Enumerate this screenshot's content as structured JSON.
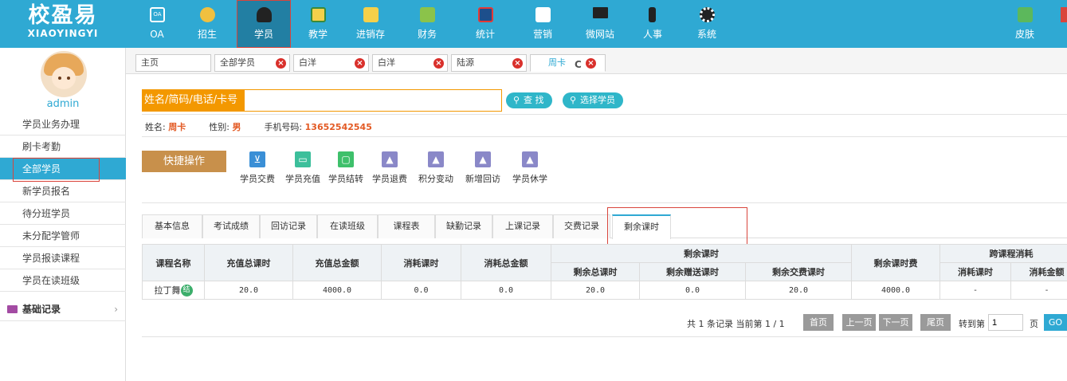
{
  "logo": {
    "cn": "校盈易",
    "en": "XIAOYINGYI"
  },
  "nav": [
    {
      "label": "OA",
      "icon": "oa-icon",
      "color": "#2fa9d3"
    },
    {
      "label": "招生",
      "icon": "recruit-icon",
      "color": "#f0c040"
    },
    {
      "label": "学员",
      "icon": "student-icon",
      "color": "#222222"
    },
    {
      "label": "教学",
      "icon": "teaching-icon",
      "color": "#f5d04a"
    },
    {
      "label": "进销存",
      "icon": "inventory-icon",
      "color": "#f5d04a"
    },
    {
      "label": "财务",
      "icon": "finance-icon",
      "color": "#8bc34a"
    },
    {
      "label": "统计",
      "icon": "statistics-icon",
      "color": "#e53935"
    },
    {
      "label": "营销",
      "icon": "marketing-icon",
      "color": "#ffffff"
    },
    {
      "label": "微网站",
      "icon": "website-icon",
      "color": "#222222"
    },
    {
      "label": "人事",
      "icon": "hr-icon",
      "color": "#222222"
    },
    {
      "label": "系统",
      "icon": "settings-icon",
      "color": "#222222"
    }
  ],
  "skin": {
    "label": "皮肤",
    "icon": "skin-icon"
  },
  "user": {
    "name": "admin"
  },
  "sidebar": {
    "items": [
      {
        "label": "学员业务办理"
      },
      {
        "label": "刷卡考勤"
      },
      {
        "label": "全部学员"
      },
      {
        "label": "新学员报名"
      },
      {
        "label": "待分班学员"
      },
      {
        "label": "未分配学管师"
      },
      {
        "label": "学员报读课程"
      },
      {
        "label": "学员在读班级"
      }
    ],
    "group": {
      "label": "基础记录",
      "chevron": "›"
    }
  },
  "page_tabs": [
    {
      "label": "主页"
    },
    {
      "label": "全部学员"
    },
    {
      "label": "白洋"
    },
    {
      "label": "白洋"
    },
    {
      "label": "陆源"
    },
    {
      "label": "周卡"
    }
  ],
  "search": {
    "placeholder": "姓名/简码/电话/卡号",
    "search_button": "查 找",
    "select_button": "选择学员"
  },
  "student": {
    "name_label": "姓名:",
    "name": "周卡",
    "gender_label": "性别:",
    "gender": "男",
    "phone_label": "手机号码:",
    "phone": "13652542545"
  },
  "quick": {
    "label": "快捷操作",
    "actions": [
      {
        "label": "学员交费",
        "icon": "cart-icon",
        "color": "#3a8fd6"
      },
      {
        "label": "学员充值",
        "icon": "wallet-icon",
        "color": "#3cbf9b"
      },
      {
        "label": "学员结转",
        "icon": "transfer-icon",
        "color": "#3ec06b"
      },
      {
        "label": "学员退费",
        "icon": "refund-icon",
        "color": "#8a88c8"
      },
      {
        "label": "积分变动",
        "icon": "points-icon",
        "color": "#8a88c8"
      },
      {
        "label": "新增回访",
        "icon": "visit-icon",
        "color": "#8a88c8"
      },
      {
        "label": "学员休学",
        "icon": "suspend-icon",
        "color": "#8a88c8"
      }
    ]
  },
  "content_tabs": [
    {
      "label": "基本信息"
    },
    {
      "label": "考试成绩"
    },
    {
      "label": "回访记录"
    },
    {
      "label": "在读班级"
    },
    {
      "label": "课程表"
    },
    {
      "label": "缺勤记录"
    },
    {
      "label": "上课记录"
    },
    {
      "label": "交费记录"
    },
    {
      "label": "剩余课时"
    }
  ],
  "table": {
    "headers": {
      "course": "课程名称",
      "recharge_hours": "充值总课时",
      "recharge_amount": "充值总金额",
      "consumed_hours": "消耗课时",
      "consumed_amount": "消耗总金额",
      "remaining_group": "剩余课时",
      "remaining_total": "剩余总课时",
      "remaining_gift": "剩余赠送课时",
      "remaining_paid": "剩余交费课时",
      "remaining_fee": "剩余课时费",
      "cross_group": "跨课程消耗",
      "cross_hours": "消耗课时",
      "cross_amount": "消耗金额"
    },
    "rows": [
      {
        "course": "拉丁舞",
        "badge": "结",
        "recharge_hours": "20.0",
        "recharge_amount": "4000.0",
        "consumed_hours": "0.0",
        "consumed_amount": "0.0",
        "remaining_total": "20.0",
        "remaining_gift": "0.0",
        "remaining_paid": "20.0",
        "remaining_fee": "4000.0",
        "cross_hours": "-",
        "cross_amount": "-"
      }
    ]
  },
  "pager": {
    "info": "共 1 条记录 当前第 1 / 1",
    "first": "首页",
    "prev": "上一页",
    "next": "下一页",
    "last": "尾页",
    "goto_label": "转到第",
    "page_value": "1",
    "page_unit": "页",
    "go": "GO"
  }
}
